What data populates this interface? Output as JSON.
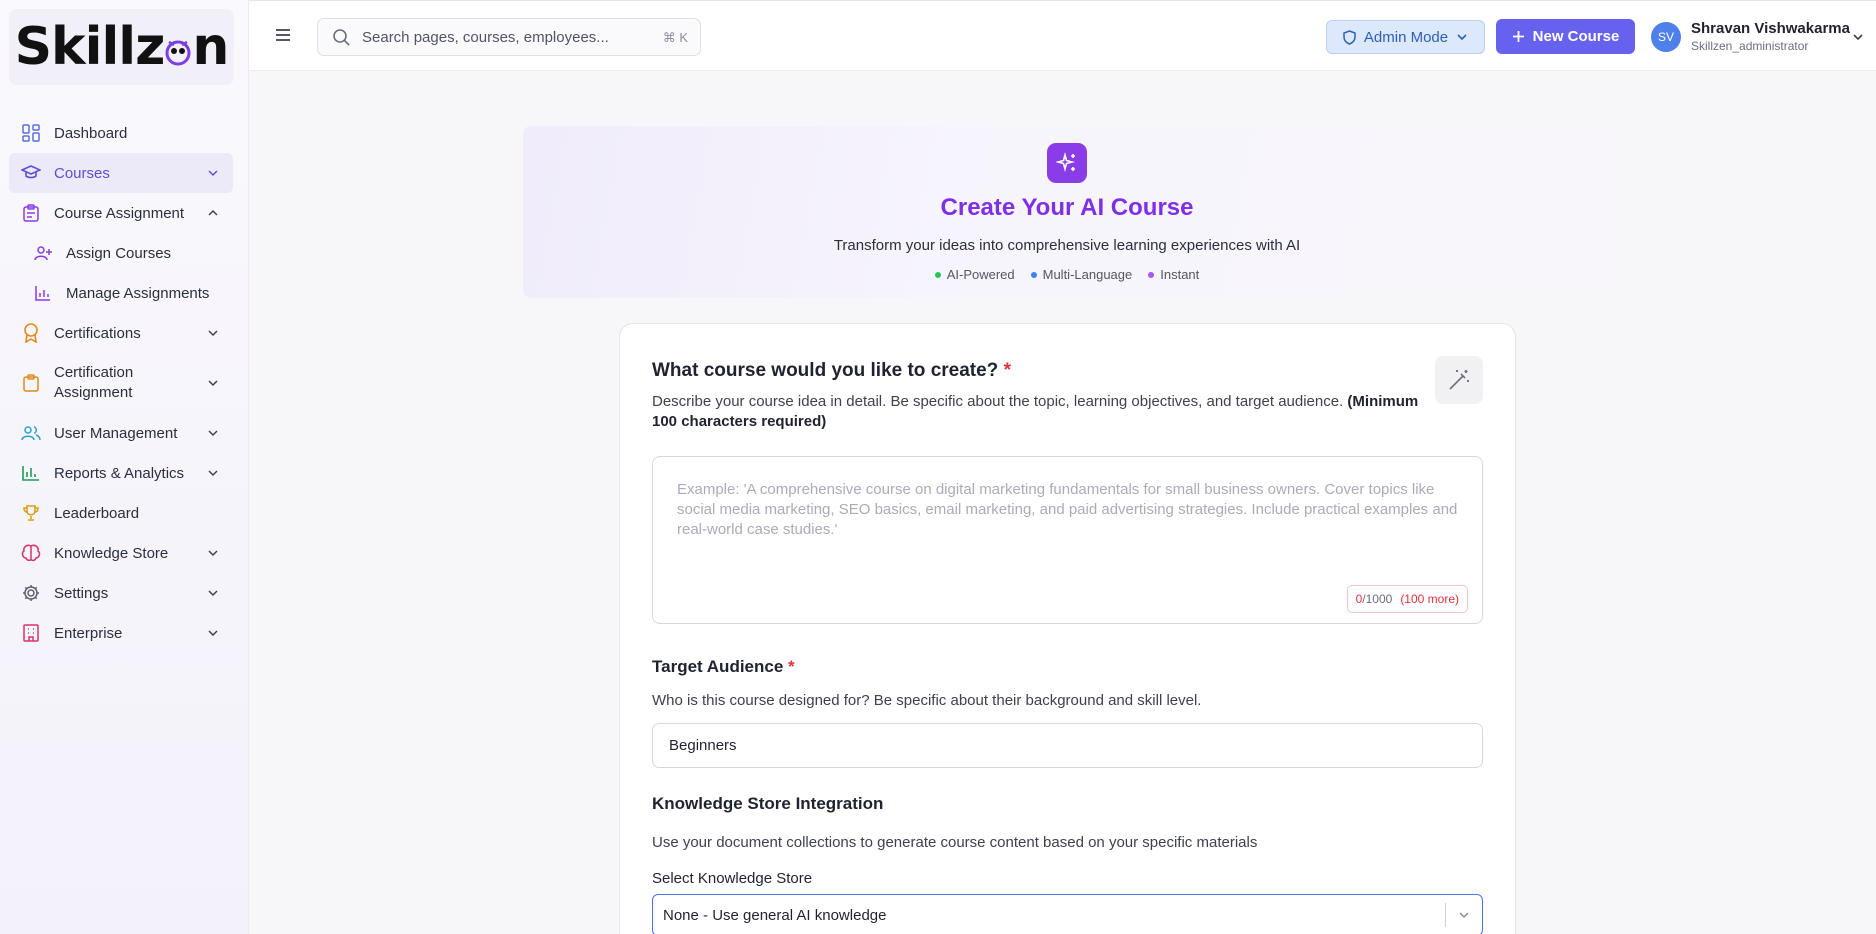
{
  "brand": {
    "logo_text": "Skillz",
    "logo_tail": "n"
  },
  "sidebar": {
    "items": [
      {
        "label": "Dashboard"
      },
      {
        "label": "Courses"
      },
      {
        "label": "Course Assignment"
      },
      {
        "label": "Assign Courses"
      },
      {
        "label": "Manage Assignments"
      },
      {
        "label": "Certifications"
      },
      {
        "label": "Certification Assignment"
      },
      {
        "label": "User Management"
      },
      {
        "label": "Reports & Analytics"
      },
      {
        "label": "Leaderboard"
      },
      {
        "label": "Knowledge Store"
      },
      {
        "label": "Settings"
      },
      {
        "label": "Enterprise"
      }
    ]
  },
  "header": {
    "search_placeholder": "Search pages, courses, employees...",
    "search_shortcut": "⌘ K",
    "admin_mode_label": "Admin Mode",
    "new_course_label": "New Course",
    "user": {
      "initials": "SV",
      "name": "Shravan Vishwakarma",
      "role": "Skillzen_administrator"
    }
  },
  "hero": {
    "title": "Create Your AI Course",
    "subtitle": "Transform your ideas into comprehensive learning experiences with AI",
    "tags": [
      {
        "label": "AI-Powered",
        "color": "#22c55e"
      },
      {
        "label": "Multi-Language",
        "color": "#3b82f6"
      },
      {
        "label": "Instant",
        "color": "#a855f7"
      }
    ]
  },
  "form": {
    "course_question": "What course would you like to create?",
    "required_mark": "*",
    "course_desc": "Describe your course idea in detail. Be specific about the topic, learning objectives, and target audience.",
    "course_desc_bold": "(Minimum 100 characters required)",
    "course_placeholder": "Example: 'A comprehensive course on digital marketing fundamentals for small business owners. Cover topics like social media marketing, SEO basics, email marketing, and paid advertising strategies. Include practical examples and real-world case studies.'",
    "counter_current": "0",
    "counter_max": "/1000",
    "counter_more": "(100 more)",
    "audience_title": "Target Audience",
    "audience_desc": "Who is this course designed for? Be specific about their background and skill level.",
    "audience_value": "Beginners",
    "ks_title": "Knowledge Store Integration",
    "ks_desc": "Use your document collections to generate course content based on your specific materials",
    "ks_label": "Select Knowledge Store",
    "ks_value": "None - Use general AI knowledge"
  },
  "colors": {
    "accent": "#6661ef",
    "hero_title": "#7f2fe6",
    "required": "#e0323f",
    "admin_bg": "#dce8fb"
  }
}
